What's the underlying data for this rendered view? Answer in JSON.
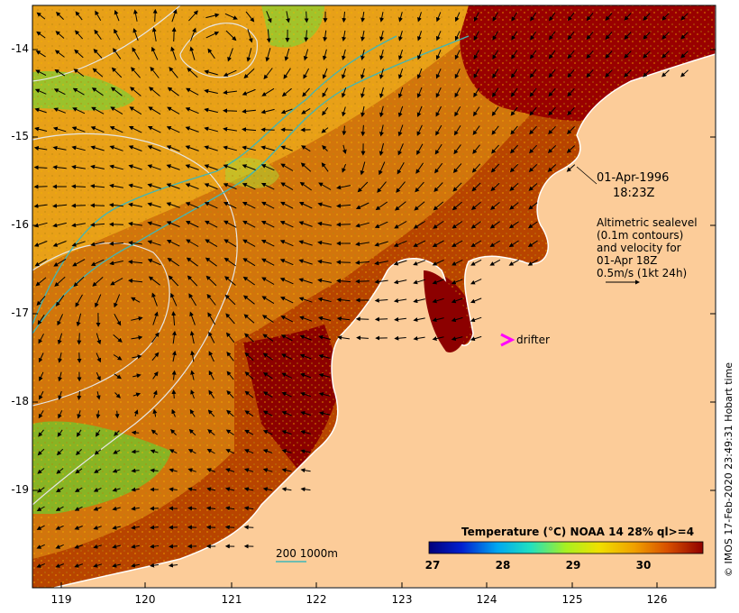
{
  "map": {
    "date_line1": "01-Apr-1996",
    "date_line2": "18:23Z",
    "alt_lines": [
      "Altimetric sealevel",
      "(0.1m contours)",
      "and velocity for",
      "01-Apr 18Z",
      "0.5m/s (1kt 24h)"
    ],
    "drifter_label": "drifter",
    "depth_label": "200  1000m",
    "credit": "© IMOS 17-Feb-2020 23:49:31 Hobart time",
    "lon_ticks": [
      "119",
      "120",
      "121",
      "122",
      "123",
      "124",
      "125",
      "126"
    ],
    "lat_ticks": [
      "-14",
      "-15",
      "-16",
      "-17",
      "-18",
      "-19"
    ],
    "colorbar": {
      "title": "Temperature (°C) NOAA 14 28% ql>=4",
      "ticks": [
        "27",
        "28",
        "29",
        "30"
      ],
      "value_range": [
        27,
        30.9
      ]
    },
    "colors": {
      "land": "#fccc99",
      "warm_ocean": "#cc5500",
      "hot_ocean": "#990000",
      "mid_ocean": "#e89c12",
      "cool_ocean": "#78c02a",
      "coast_outline": "#ffffff",
      "contour": "#dddddd",
      "isobath": "#3fb7b7",
      "drifter": "#ff00ff"
    }
  }
}
